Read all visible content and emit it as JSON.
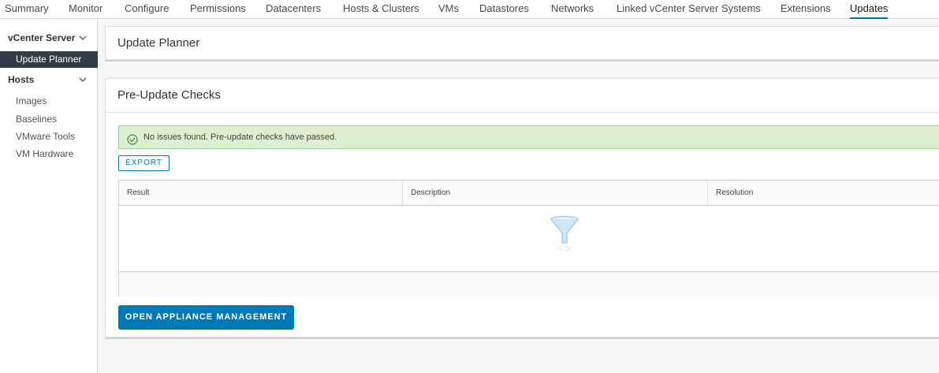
{
  "tabs": [
    {
      "label": "Summary"
    },
    {
      "label": "Monitor"
    },
    {
      "label": "Configure"
    },
    {
      "label": "Permissions"
    },
    {
      "label": "Datacenters"
    },
    {
      "label": "Hosts & Clusters"
    },
    {
      "label": "VMs"
    },
    {
      "label": "Datastores"
    },
    {
      "label": "Networks"
    },
    {
      "label": "Linked vCenter Server Systems"
    },
    {
      "label": "Extensions"
    },
    {
      "label": "Updates"
    }
  ],
  "sidebar": {
    "group_vcenter": "vCenter Server",
    "active_item": "Update Planner",
    "group_hosts": "Hosts",
    "items": [
      {
        "label": "Images"
      },
      {
        "label": "Baselines"
      },
      {
        "label": "VMware Tools"
      },
      {
        "label": "VM Hardware"
      }
    ]
  },
  "planner": {
    "title": "Update Planner"
  },
  "checks": {
    "title": "Pre-Update Checks",
    "alert_text": "No issues found. Pre-update checks have passed.",
    "export_label": "EXPORT",
    "columns": [
      "Result",
      "Description",
      "Resolution"
    ],
    "open_button_label": "OPEN APPLIANCE MANAGEMENT"
  },
  "colors": {
    "accent": "#0079b8",
    "success_bg": "#dff0d0",
    "sidebar_active": "#313c49"
  }
}
